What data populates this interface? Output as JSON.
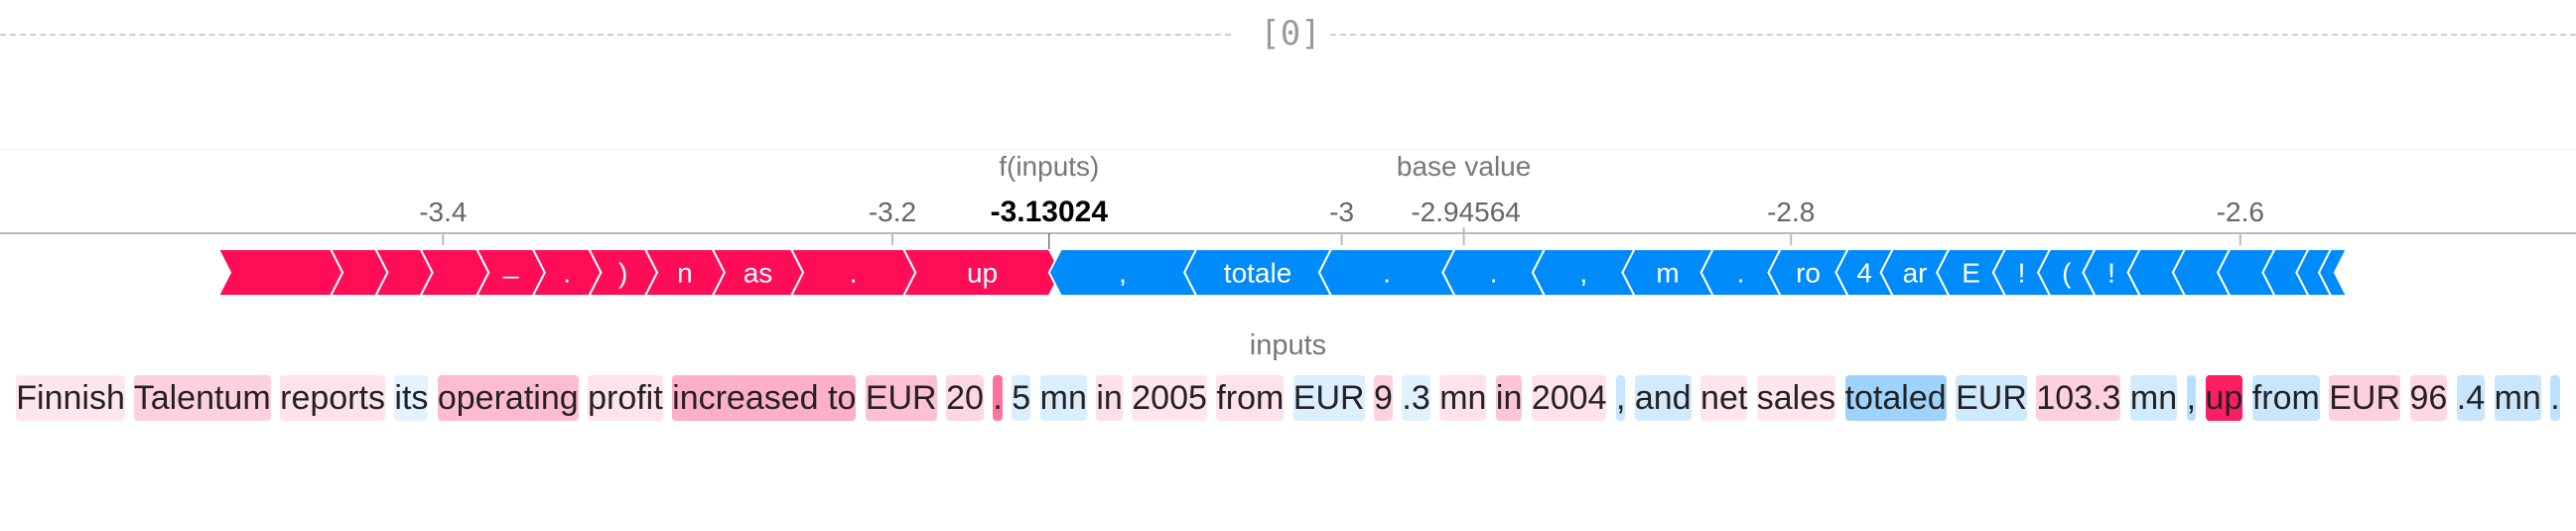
{
  "title": "[0]",
  "inputs_label": "inputs",
  "chart_data": {
    "type": "force",
    "base_value": -2.94564,
    "base_value_label": "base value",
    "base_value_text": "-2.94564",
    "output_value": -3.13024,
    "output_value_label": "f(inputs)",
    "output_value_text": "-3.13024",
    "xlim": [
      -3.5,
      -2.55
    ],
    "ticks": [
      {
        "value": -3.4,
        "label": "-3.4"
      },
      {
        "value": -3.2,
        "label": "-3.2"
      },
      {
        "value": -3.0,
        "label": "-3"
      },
      {
        "value": -2.8,
        "label": "-2.8"
      },
      {
        "value": -2.6,
        "label": "-2.6"
      }
    ],
    "colors": {
      "positive": "#ff0d57",
      "negative": "#008bfb"
    },
    "positive_segments": [
      {
        "from": -3.5,
        "to": -3.45,
        "label": ""
      },
      {
        "from": -3.45,
        "to": -3.43,
        "label": ""
      },
      {
        "from": -3.43,
        "to": -3.41,
        "label": ""
      },
      {
        "from": -3.41,
        "to": -3.385,
        "label": ""
      },
      {
        "from": -3.385,
        "to": -3.36,
        "label": "̶"
      },
      {
        "from": -3.36,
        "to": -3.335,
        "label": "."
      },
      {
        "from": -3.335,
        "to": -3.31,
        "label": ")"
      },
      {
        "from": -3.31,
        "to": -3.28,
        "label": "n"
      },
      {
        "from": -3.28,
        "to": -3.245,
        "label": "as"
      },
      {
        "from": -3.245,
        "to": -3.195,
        "label": "."
      },
      {
        "from": -3.195,
        "to": -3.13024,
        "label": "up"
      }
    ],
    "negative_segments": [
      {
        "from": -3.13024,
        "to": -3.07,
        "label": ","
      },
      {
        "from": -3.07,
        "to": -3.01,
        "label": "totale"
      },
      {
        "from": -3.01,
        "to": -2.955,
        "label": "."
      },
      {
        "from": -2.955,
        "to": -2.915,
        "label": "."
      },
      {
        "from": -2.915,
        "to": -2.875,
        "label": ","
      },
      {
        "from": -2.875,
        "to": -2.84,
        "label": "m"
      },
      {
        "from": -2.84,
        "to": -2.81,
        "label": "."
      },
      {
        "from": -2.81,
        "to": -2.78,
        "label": "ro"
      },
      {
        "from": -2.78,
        "to": -2.76,
        "label": "4"
      },
      {
        "from": -2.76,
        "to": -2.735,
        "label": "ar"
      },
      {
        "from": -2.735,
        "to": -2.71,
        "label": "E"
      },
      {
        "from": -2.71,
        "to": -2.69,
        "label": "!"
      },
      {
        "from": -2.69,
        "to": -2.67,
        "label": "("
      },
      {
        "from": -2.67,
        "to": -2.65,
        "label": "!"
      },
      {
        "from": -2.65,
        "to": -2.63,
        "label": ""
      },
      {
        "from": -2.63,
        "to": -2.61,
        "label": ""
      },
      {
        "from": -2.61,
        "to": -2.59,
        "label": ""
      },
      {
        "from": -2.59,
        "to": -2.575,
        "label": ""
      },
      {
        "from": -2.575,
        "to": -2.565,
        "label": ""
      },
      {
        "from": -2.565,
        "to": -2.558,
        "label": ""
      }
    ]
  },
  "tokens": [
    {
      "text": "Finnish",
      "impact": 0.02
    },
    {
      "text": "Talentum",
      "impact": 0.12
    },
    {
      "text": "reports",
      "impact": 0.04
    },
    {
      "text": "its",
      "impact": -0.05
    },
    {
      "text": "operating",
      "impact": 0.22
    },
    {
      "text": "profit",
      "impact": 0.03
    },
    {
      "text": "increased to",
      "impact": 0.28
    },
    {
      "text": "EUR",
      "impact": 0.2
    },
    {
      "text": "20",
      "impact": 0.1
    },
    {
      "text": ".",
      "impact": 0.55
    },
    {
      "text": "5",
      "impact": -0.15
    },
    {
      "text": "mn",
      "impact": -0.15
    },
    {
      "text": "in",
      "impact": 0.05
    },
    {
      "text": "2005",
      "impact": 0.02
    },
    {
      "text": "from",
      "impact": 0.04
    },
    {
      "text": "EUR",
      "impact": -0.12
    },
    {
      "text": "9",
      "impact": 0.12
    },
    {
      "text": ".3",
      "impact": -0.08
    },
    {
      "text": "mn",
      "impact": 0.04
    },
    {
      "text": "in",
      "impact": 0.18
    },
    {
      "text": "2004",
      "impact": 0.04
    },
    {
      "text": ",",
      "impact": -0.25
    },
    {
      "text": "and",
      "impact": -0.2
    },
    {
      "text": "net",
      "impact": 0.02
    },
    {
      "text": "sales",
      "impact": 0.02
    },
    {
      "text": "totaled",
      "impact": -0.6
    },
    {
      "text": "EUR",
      "impact": -0.22
    },
    {
      "text": "103.3",
      "impact": 0.12
    },
    {
      "text": "mn",
      "impact": -0.2
    },
    {
      "text": ",",
      "impact": -0.4
    },
    {
      "text": "up",
      "impact": 0.95
    },
    {
      "text": "from",
      "impact": -0.25
    },
    {
      "text": "EUR",
      "impact": 0.12
    },
    {
      "text": "96",
      "impact": 0.1
    },
    {
      "text": ".4",
      "impact": -0.28
    },
    {
      "text": "mn",
      "impact": -0.25
    },
    {
      "text": ".",
      "impact": -0.35
    }
  ]
}
